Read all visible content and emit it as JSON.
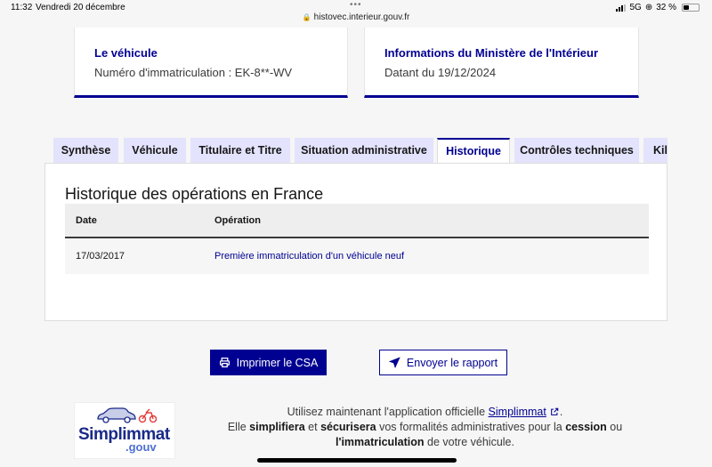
{
  "status_bar": {
    "time": "11:32",
    "date": "Vendredi 20 décembre",
    "url": "histovec.interieur.gouv.fr",
    "network": "5G",
    "battery": "32 %"
  },
  "cards": {
    "vehicle": {
      "title": "Le véhicule",
      "plate_line": "Numéro d'immatriculation : EK-8**-WV"
    },
    "ministry": {
      "title": "Informations du Ministère de l'Intérieur",
      "date_line": "Datant du 19/12/2024"
    }
  },
  "tabs": [
    {
      "label": "Synthèse",
      "active": false
    },
    {
      "label": "Véhicule",
      "active": false
    },
    {
      "label": "Titulaire et Titre",
      "active": false
    },
    {
      "label": "Situation administrative",
      "active": false
    },
    {
      "label": "Historique",
      "active": true
    },
    {
      "label": "Contrôles techniques",
      "active": false
    },
    {
      "label": "Kilo",
      "active": false
    }
  ],
  "history": {
    "title": "Historique des opérations en France",
    "headers": [
      "Date",
      "Opération"
    ],
    "rows": [
      {
        "date": "17/03/2017",
        "operation": "Première immatriculation d'un véhicule neuf"
      }
    ]
  },
  "actions": {
    "print_label": "Imprimer le CSA",
    "send_label": "Envoyer le rapport"
  },
  "promo": {
    "logo_word1": "Simplimmat",
    "logo_word2": ".gouv",
    "line1_prefix": "Utilisez maintenant l'application officielle ",
    "line1_link": "Simplimmat",
    "line1_suffix": ".",
    "line2_a": "Elle ",
    "line2_b": "simplifiera",
    "line2_c": " et ",
    "line2_d": "sécurisera",
    "line2_e": " vos formalités administratives pour la ",
    "line2_f": "cession",
    "line2_g": " ou",
    "line3_a": "l'immatriculation",
    "line3_b": " de votre véhicule."
  },
  "colors": {
    "primary": "#000091",
    "tab_bg": "#e3e3fd",
    "page_bg": "#f6f6f6"
  },
  "icons": [
    "lock-icon",
    "signal-icon",
    "battery-icon",
    "printer-icon",
    "send-icon",
    "external-link-icon"
  ]
}
